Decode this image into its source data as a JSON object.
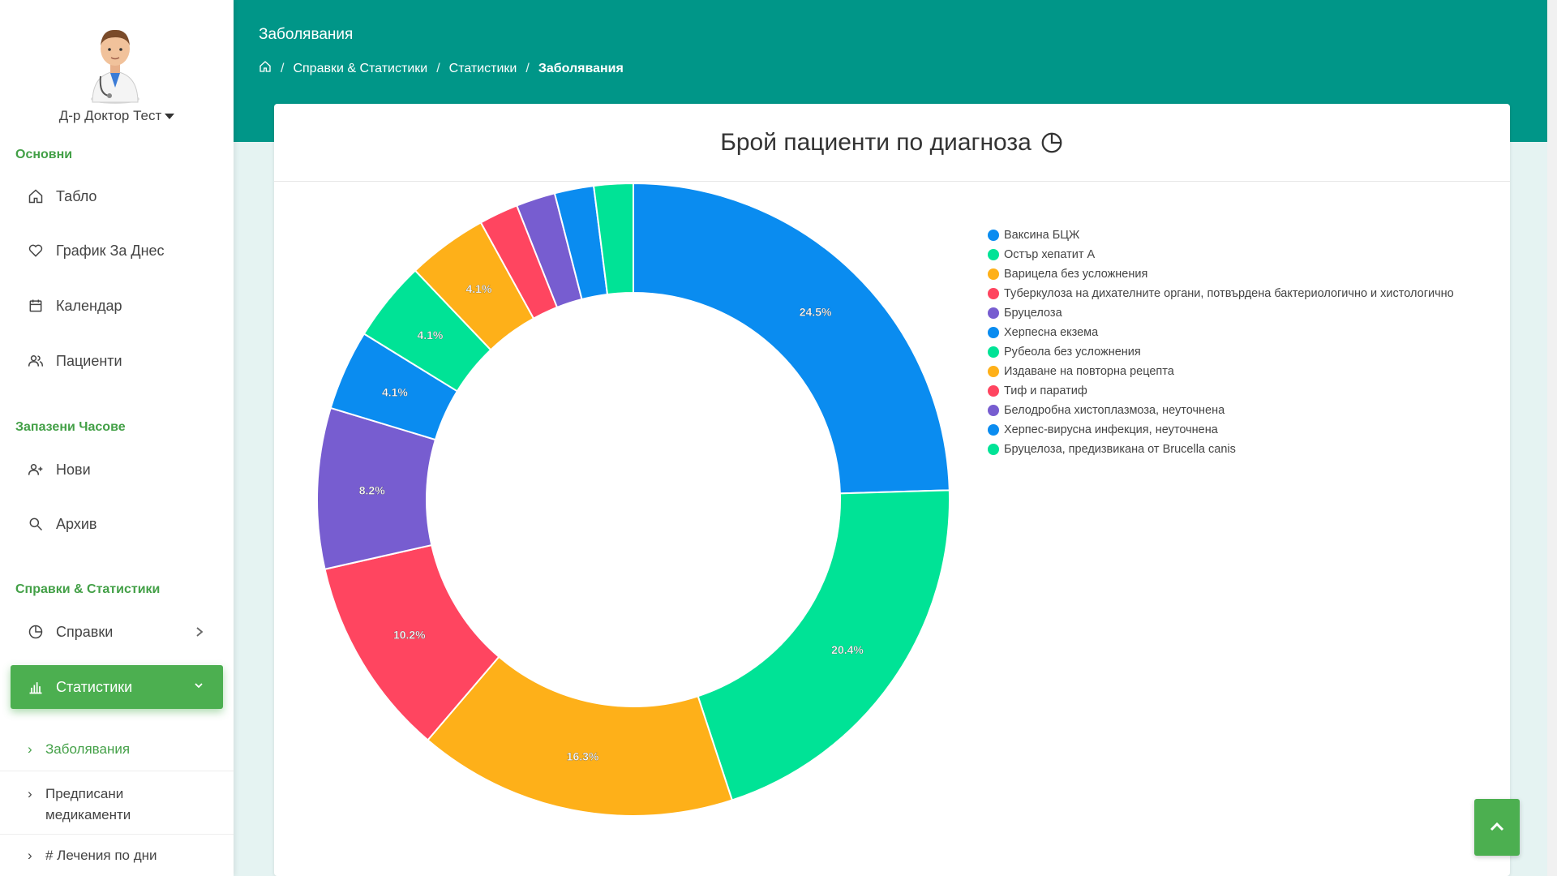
{
  "user": {
    "name": "Д-р Доктор Тест"
  },
  "sidebar": {
    "sections": {
      "main": "Основни",
      "appointments": "Запазени Часове",
      "reports": "Справки & Статистики"
    },
    "items": {
      "dashboard": "Табло",
      "today": "График За Днес",
      "calendar": "Календар",
      "patients": "Пациенти",
      "new": "Нови",
      "archive": "Архив",
      "references": "Справки",
      "statistics": "Статистики"
    },
    "subitems": {
      "diseases": "Заболявания",
      "medications_line1": "Предписани",
      "medications_line2": "медикаменти",
      "treatments": "# Лечения по дни"
    }
  },
  "header": {
    "title": "Заболявания",
    "breadcrumb": [
      "Справки & Статистики",
      "Статистики",
      "Заболявания"
    ]
  },
  "card": {
    "title": "Брой пациенти по диагноза"
  },
  "chart_data": {
    "type": "pie",
    "variant": "doughnut",
    "title": "Брой пациенти по диагноза",
    "legend_position": "right",
    "slices": [
      {
        "label": "Ваксина БЦЖ",
        "value": 24.5,
        "color": "#0a8cf0"
      },
      {
        "label": "Остър хепатит A",
        "value": 20.4,
        "color": "#00e396"
      },
      {
        "label": "Варицела без усложнения",
        "value": 16.3,
        "color": "#feb019"
      },
      {
        "label": "Туберкулоза на дихателните органи, потвърдена бактериологично и хистологично",
        "value": 10.2,
        "color": "#ff4560"
      },
      {
        "label": "Бруцелоза",
        "value": 8.2,
        "color": "#775dd0"
      },
      {
        "label": "Херпесна екзема",
        "value": 4.1,
        "color": "#0a8cf0"
      },
      {
        "label": "Рубеола без усложнения",
        "value": 4.1,
        "color": "#00e396"
      },
      {
        "label": "Издаване на повторна рецепта",
        "value": 4.1,
        "color": "#feb019"
      },
      {
        "label": "Тиф и паратиф",
        "value": 2.0,
        "color": "#ff4560"
      },
      {
        "label": "Белодробна хистоплазмоза, неуточнена",
        "value": 2.0,
        "color": "#775dd0"
      },
      {
        "label": "Херпес-вирусна инфекция, неуточнена",
        "value": 2.0,
        "color": "#0a8cf0"
      },
      {
        "label": "Бруцелоза, предизвикана от Brucella canis",
        "value": 2.0,
        "color": "#00e396"
      }
    ],
    "data_labels": [
      "24.5%",
      "20.4%",
      "16.3%",
      "10.2%",
      "8.2%",
      "4.1%",
      "4.1%",
      "4.1%",
      "",
      "",
      "",
      ""
    ]
  }
}
